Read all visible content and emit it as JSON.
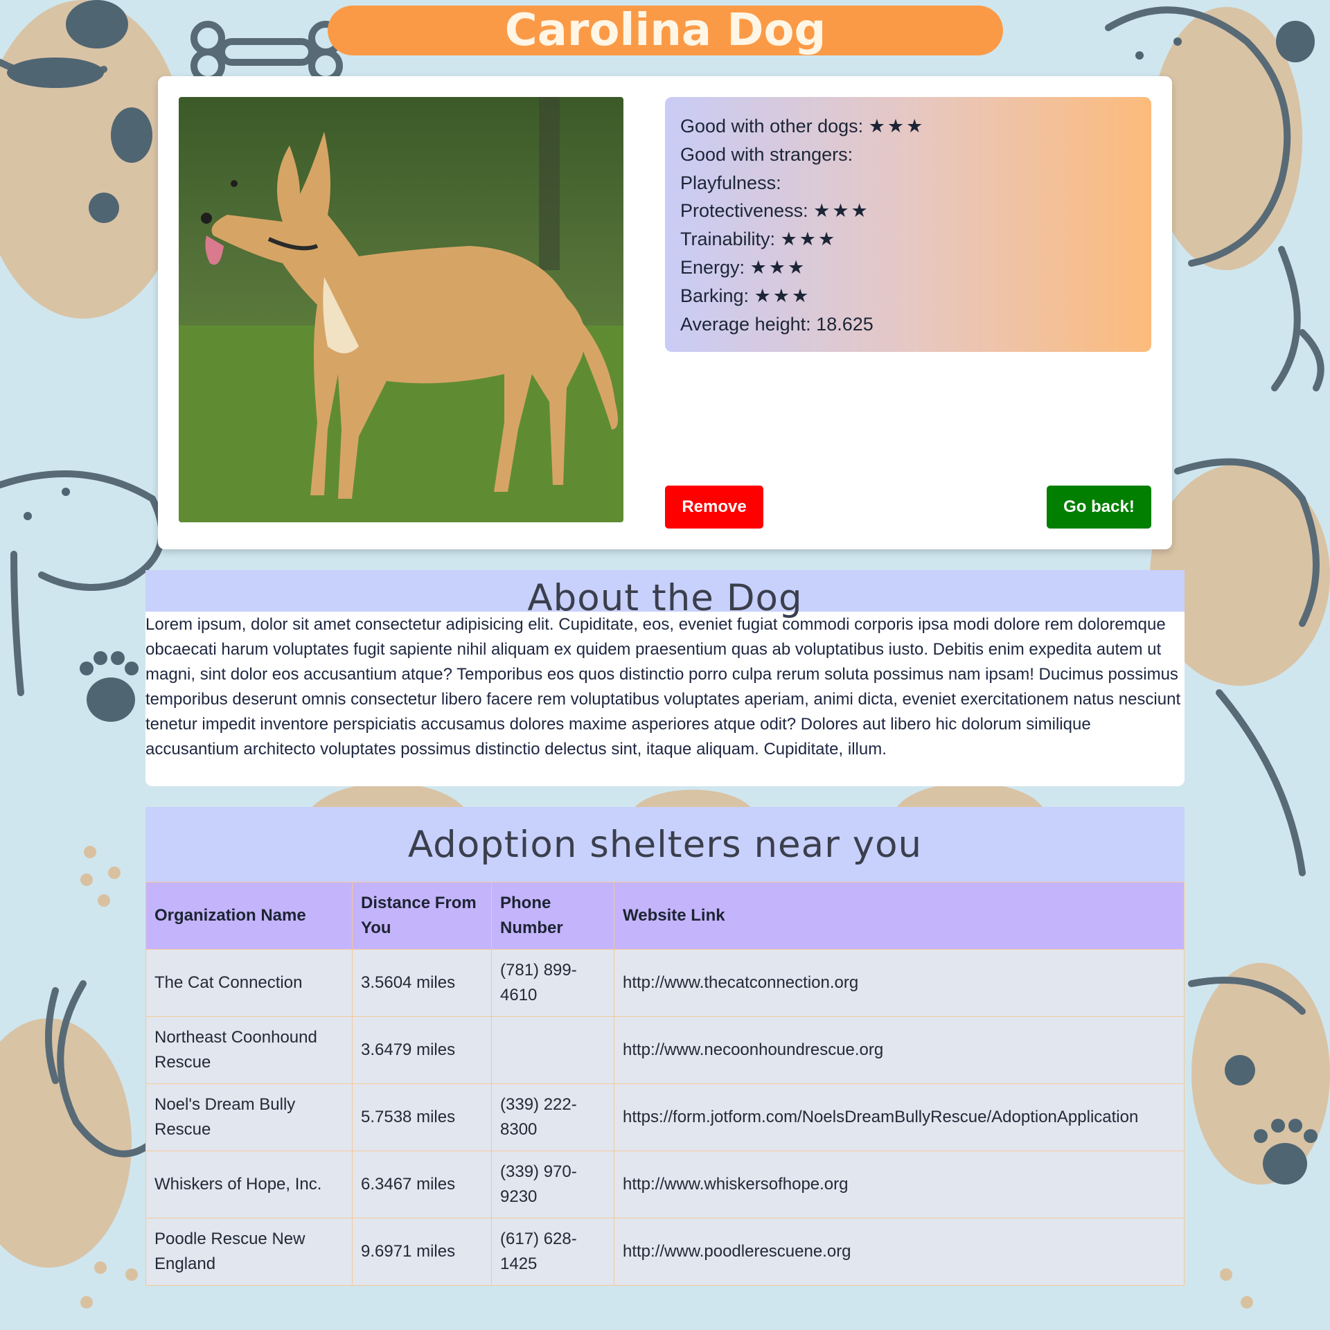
{
  "page": {
    "title": "Carolina Dog"
  },
  "dog_card": {
    "photo_alt": "Carolina Dog",
    "traits": [
      {
        "label": "Good with other dogs:",
        "stars": "★★★"
      },
      {
        "label": "Good with strangers:",
        "stars": ""
      },
      {
        "label": "Playfulness:",
        "stars": ""
      },
      {
        "label": "Protectiveness:",
        "stars": "★★★"
      },
      {
        "label": "Trainability:",
        "stars": "★★★"
      },
      {
        "label": "Energy:",
        "stars": "★★★"
      },
      {
        "label": "Barking:",
        "stars": "★★★"
      },
      {
        "label": "Average height:",
        "stars": "18.625"
      }
    ],
    "remove_label": "Remove",
    "back_label": "Go back!"
  },
  "about": {
    "heading": "About the Dog",
    "body": "Lorem ipsum, dolor sit amet consectetur adipisicing elit. Cupiditate, eos, eveniet fugiat commodi corporis ipsa modi dolore rem doloremque obcaecati harum voluptates fugit sapiente nihil aliquam ex quidem praesentium quas ab voluptatibus iusto. Debitis enim expedita autem ut magni, sint dolor eos accusantium atque? Temporibus eos quos distinctio porro culpa rerum soluta possimus nam ipsam! Ducimus possimus temporibus deserunt omnis consectetur libero facere rem voluptatibus voluptates aperiam, animi dicta, eveniet exercitationem natus nesciunt tenetur impedit inventore perspiciatis accusamus dolores maxime asperiores atque odit? Dolores aut libero hic dolorum similique accusantium architecto voluptates possimus distinctio delectus sint, itaque aliquam. Cupiditate, illum."
  },
  "shelters": {
    "heading": "Adoption shelters near you",
    "columns": [
      "Organization Name",
      "Distance From You",
      "Phone Number",
      "Website Link"
    ],
    "rows": [
      {
        "name": "The Cat Connection",
        "distance": "3.5604 miles",
        "phone": "(781) 899-4610",
        "website": "http://www.thecatconnection.org"
      },
      {
        "name": "Northeast Coonhound Rescue",
        "distance": "3.6479 miles",
        "phone": "",
        "website": "http://www.necoonhoundrescue.org"
      },
      {
        "name": "Noel's Dream Bully Rescue",
        "distance": "5.7538 miles",
        "phone": "(339) 222-8300",
        "website": "https://form.jotform.com/NoelsDreamBullyRescue/AdoptionApplication"
      },
      {
        "name": "Whiskers of Hope, Inc.",
        "distance": "6.3467 miles",
        "phone": "(339) 970-9230",
        "website": "http://www.whiskersofhope.org"
      },
      {
        "name": "Poodle Rescue New England",
        "distance": "9.6971 miles",
        "phone": "(617) 628-1425",
        "website": "http://www.poodlerescuene.org"
      }
    ]
  },
  "colors": {
    "background": "#cfe6ee",
    "title_pill": "#fb9a46",
    "remove_button": "#ff0000",
    "back_button": "#007f00",
    "section_header": "#c8d0fc",
    "table_header": "#c4b4fc",
    "table_row": "#e1e6ef"
  }
}
